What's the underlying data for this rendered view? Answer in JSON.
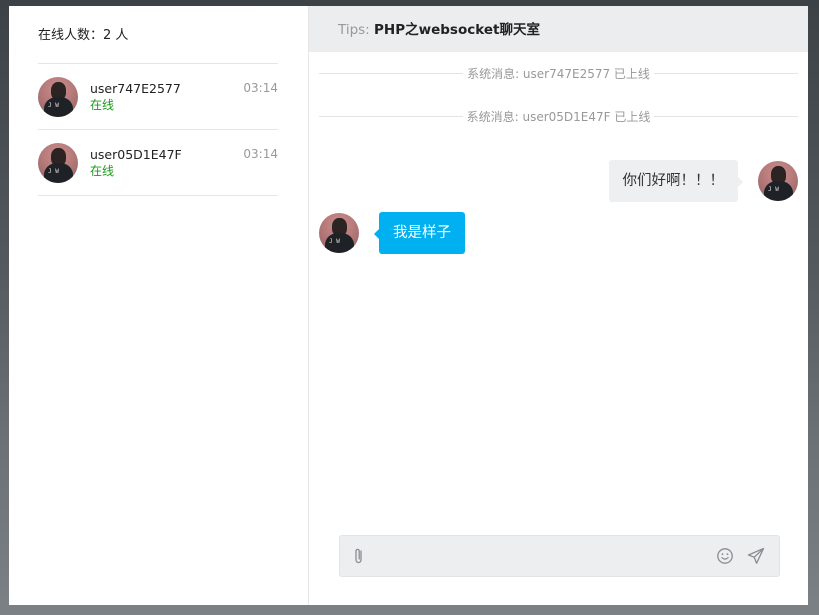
{
  "sidebar": {
    "online_label": "在线人数：",
    "online_count": "2 人",
    "users": [
      {
        "name": "user747E2577",
        "status": "在线",
        "time": "03:14"
      },
      {
        "name": "user05D1E47F",
        "status": "在线",
        "time": "03:14"
      }
    ]
  },
  "chat": {
    "tips_label": "Tips: ",
    "tips_title": "PHP之websocket聊天室",
    "system_messages": [
      "系统消息: user747E2577 已上线",
      "系统消息: user05D1E47F 已上线"
    ],
    "messages": [
      {
        "side": "right",
        "text": "你们好啊！！！"
      },
      {
        "side": "left",
        "text": "我是样子"
      }
    ],
    "input": {
      "value": "",
      "placeholder": ""
    }
  },
  "icons": {
    "attach": "paperclip-icon",
    "emoji": "smiley-icon",
    "send": "paper-plane-icon"
  },
  "colors": {
    "status_online": "#1a9a1a",
    "bubble_self": "#eeeff1",
    "bubble_other": "#00b0f0",
    "header_bg": "#ecedef"
  }
}
